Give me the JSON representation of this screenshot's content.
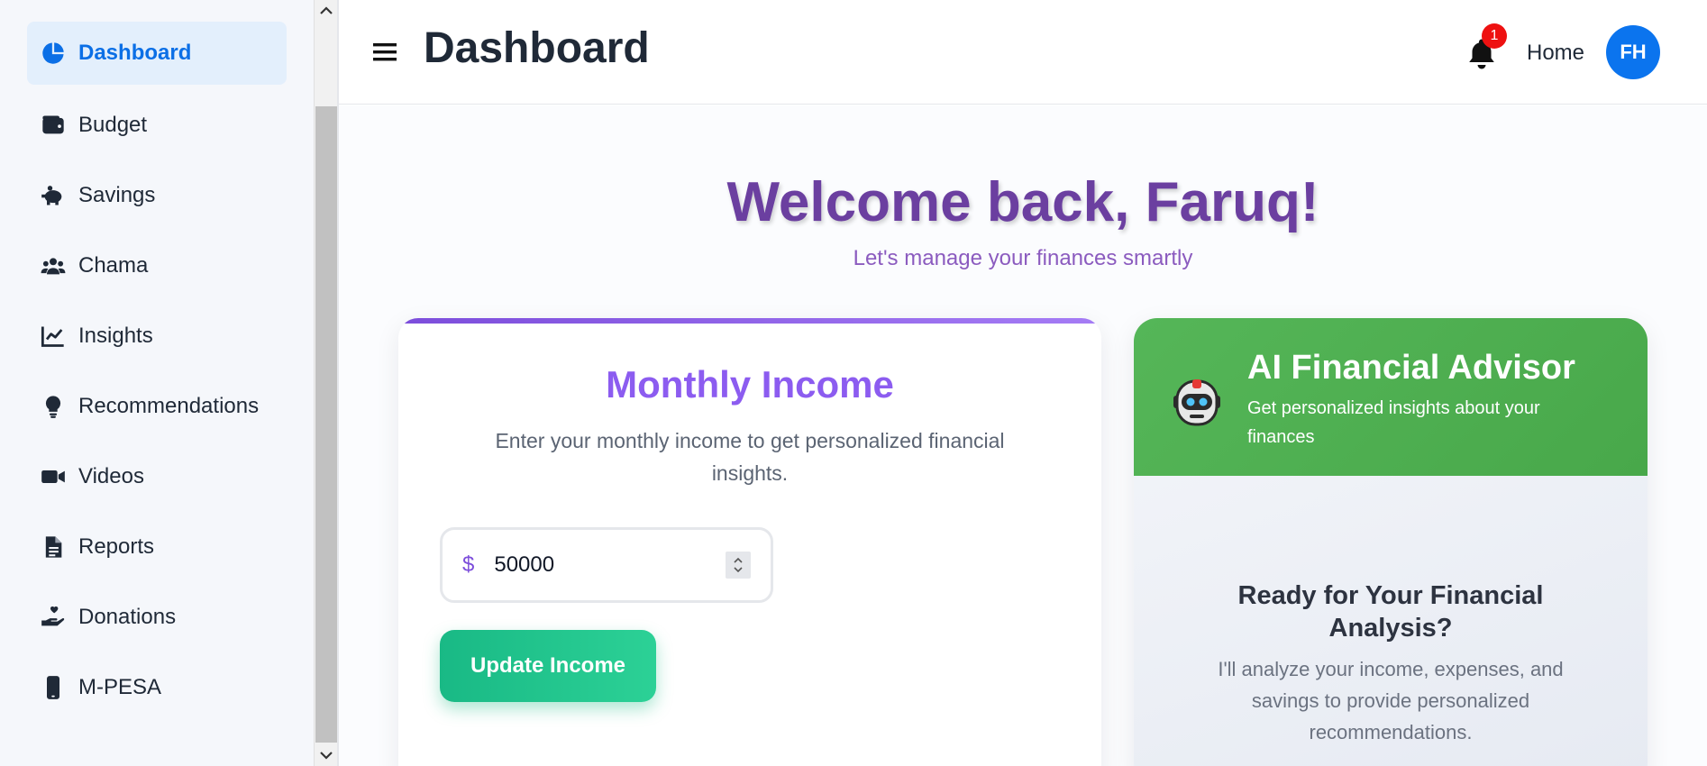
{
  "sidebar": {
    "items": [
      {
        "label": "Dashboard",
        "icon": "pie-chart-icon",
        "active": true
      },
      {
        "label": "Budget",
        "icon": "wallet-icon"
      },
      {
        "label": "Savings",
        "icon": "piggy-bank-icon"
      },
      {
        "label": "Chama",
        "icon": "users-icon"
      },
      {
        "label": "Insights",
        "icon": "line-chart-icon"
      },
      {
        "label": "Recommendations",
        "icon": "lightbulb-icon"
      },
      {
        "label": "Videos",
        "icon": "video-icon"
      },
      {
        "label": "Reports",
        "icon": "file-icon"
      },
      {
        "label": "Donations",
        "icon": "hand-heart-icon"
      },
      {
        "label": "M-PESA",
        "icon": "mobile-phone-icon"
      }
    ]
  },
  "header": {
    "title": "Dashboard",
    "notification_count": "1",
    "home_label": "Home",
    "avatar_initials": "FH"
  },
  "main": {
    "welcome_title": "Welcome back, Faruq!",
    "welcome_subtitle": "Let's manage your finances smartly"
  },
  "income_card": {
    "title": "Monthly Income",
    "description": "Enter your monthly income to get personalized financial insights.",
    "currency_symbol": "$",
    "income_value": "50000",
    "update_button": "Update Income"
  },
  "ai_card": {
    "title": "AI Financial Advisor",
    "subtitle": "Get personalized insights about your finances",
    "ready_title": "Ready for Your Financial Analysis?",
    "ready_description": "I'll analyze your income, expenses, and savings to provide personalized recommendations."
  },
  "colors": {
    "accent_blue": "#0b6fe6",
    "purple": "#8c5cf0",
    "green": "#19b985",
    "advisor_green": "#55b658",
    "badge_red": "#ee1111"
  }
}
